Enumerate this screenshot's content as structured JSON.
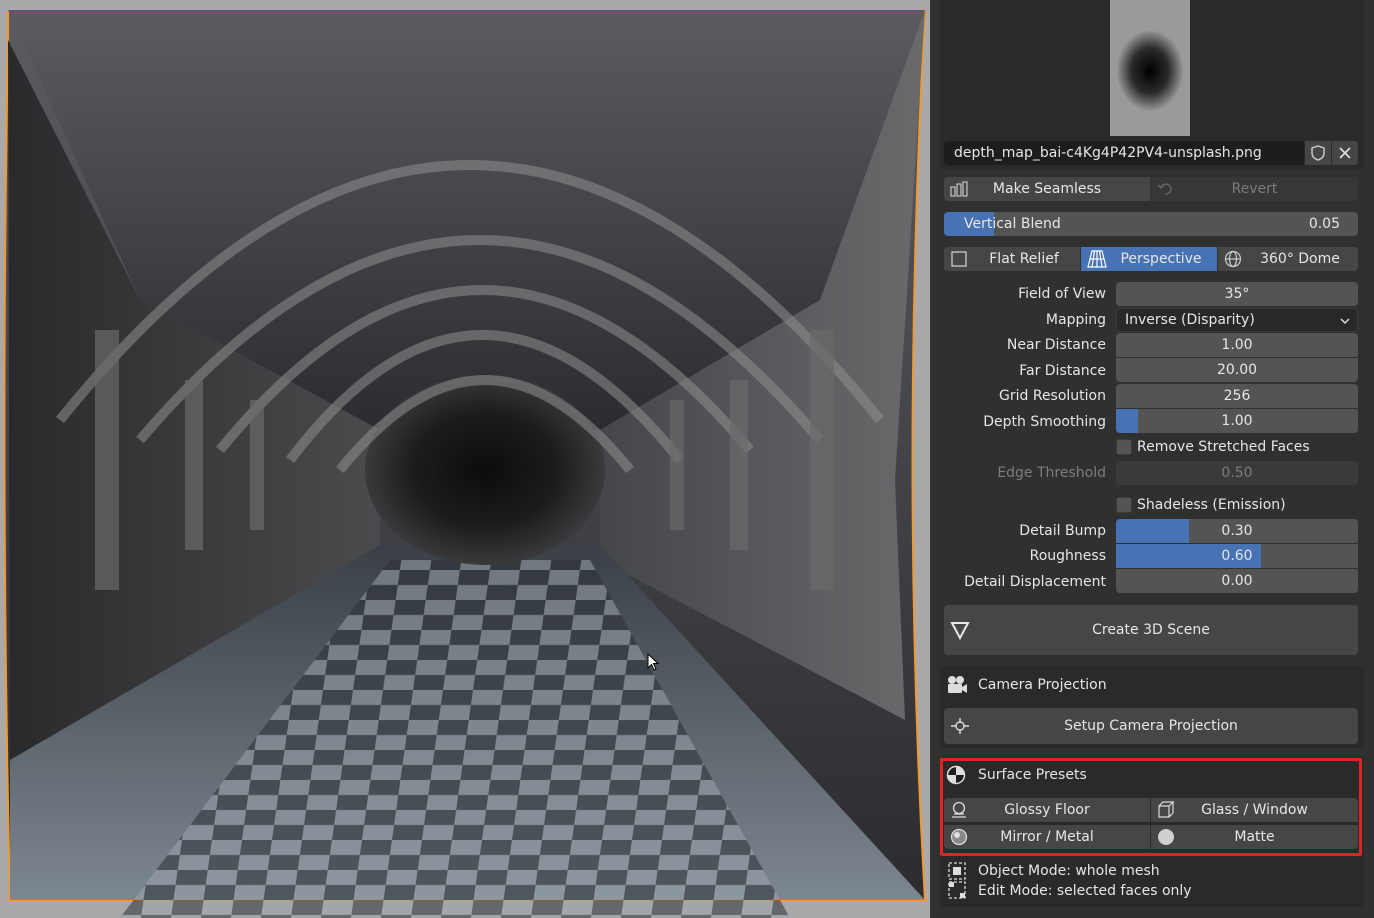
{
  "image_panel": {
    "filename": "depth_map_bai-c4Kg4P42PV4-unsplash.png",
    "make_seamless_label": "Make Seamless",
    "revert_label": "Revert",
    "vertical_blend": {
      "label": "Vertical Blend",
      "value": "0.05",
      "fill_fraction": 0.12
    }
  },
  "projection_modes": [
    {
      "label": "Flat Relief",
      "active": false
    },
    {
      "label": "Perspective",
      "active": true
    },
    {
      "label": "360° Dome",
      "active": false
    }
  ],
  "properties": {
    "field_of_view": {
      "label": "Field of View",
      "value": "35°"
    },
    "mapping": {
      "label": "Mapping",
      "value": "Inverse (Disparity)"
    },
    "near_distance": {
      "label": "Near Distance",
      "value": "1.00"
    },
    "far_distance": {
      "label": "Far Distance",
      "value": "20.00"
    },
    "grid_resolution": {
      "label": "Grid Resolution",
      "value": "256"
    },
    "depth_smoothing": {
      "label": "Depth Smoothing",
      "value": "1.00",
      "fill_fraction": 0.09
    },
    "remove_stretched": {
      "label": "Remove Stretched Faces",
      "checked": false
    },
    "edge_threshold": {
      "label": "Edge Threshold",
      "value": "0.50"
    },
    "shadeless": {
      "label": "Shadeless (Emission)",
      "checked": false
    },
    "detail_bump": {
      "label": "Detail Bump",
      "value": "0.30",
      "fill_fraction": 0.3
    },
    "roughness": {
      "label": "Roughness",
      "value": "0.60",
      "fill_fraction": 0.6
    },
    "detail_displacement": {
      "label": "Detail Displacement",
      "value": "0.00",
      "fill_fraction": 0.0
    }
  },
  "create_scene_label": "Create 3D Scene",
  "camera_projection": {
    "title": "Camera Projection",
    "setup_label": "Setup Camera Projection"
  },
  "surface_presets": {
    "title": "Surface Presets",
    "buttons": [
      "Glossy Floor",
      "Glass / Window",
      "Mirror / Metal",
      "Matte"
    ]
  },
  "footer": {
    "object_mode": "Object Mode: whole mesh",
    "edit_mode": "Edit Mode: selected faces only"
  },
  "colors": {
    "accent": "#4772b3",
    "highlight": "#e02424",
    "selection_outline": "#f0a030"
  }
}
